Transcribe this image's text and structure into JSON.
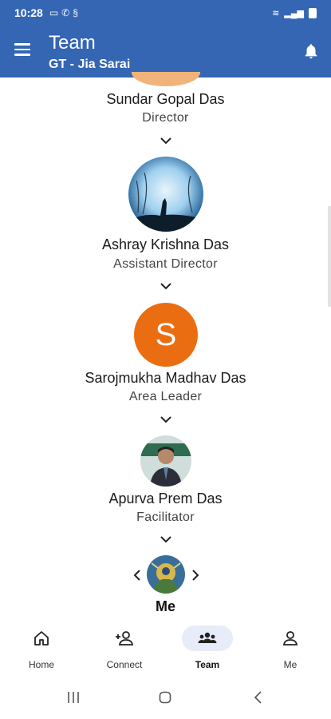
{
  "status_bar": {
    "time": "10:28"
  },
  "app_bar": {
    "title": "Team",
    "subtitle": "GT - Jia Sarai"
  },
  "org_chain": [
    {
      "name": "Sundar Gopal Das",
      "role": "Director"
    },
    {
      "name": "Ashray Krishna Das",
      "role": "Assistant Director"
    },
    {
      "name": "Sarojmukha Madhav Das",
      "role": "Area Leader",
      "initial": "S"
    },
    {
      "name": "Apurva Prem Das",
      "role": "Facilitator"
    }
  ],
  "me": {
    "label": "Me"
  },
  "bottom_nav": [
    {
      "label": "Home",
      "icon": "home-icon"
    },
    {
      "label": "Connect",
      "icon": "add-person-icon"
    },
    {
      "label": "Team",
      "icon": "group-icon",
      "active": true
    },
    {
      "label": "Me",
      "icon": "person-icon"
    }
  ],
  "colors": {
    "app_bar": "#3566b3",
    "avatar_orange": "#ea6e11",
    "nav_pill": "#e6ecf8"
  }
}
